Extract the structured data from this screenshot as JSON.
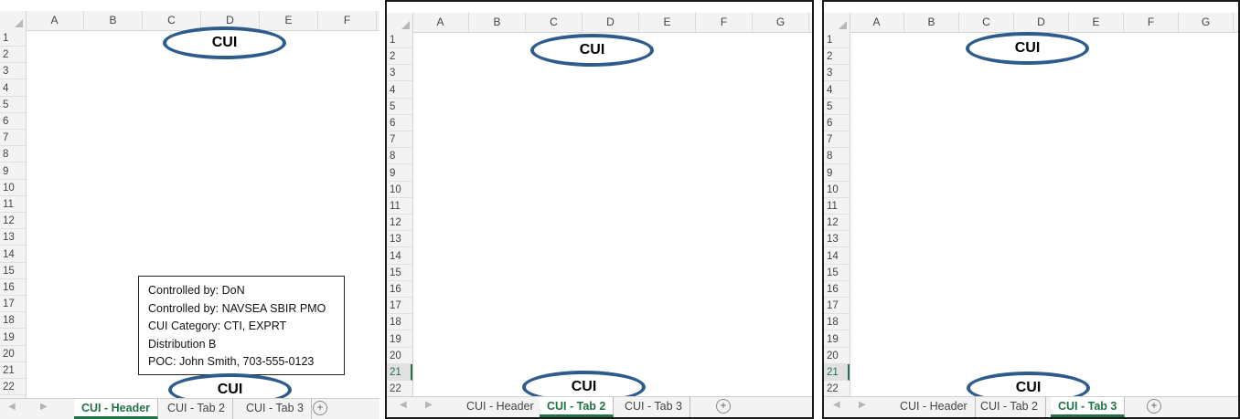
{
  "panes": [
    {
      "columns": [
        "A",
        "B",
        "C",
        "D",
        "E",
        "F"
      ],
      "rows": [
        "1",
        "2",
        "3",
        "4",
        "5",
        "6",
        "7",
        "8",
        "9",
        "10",
        "11",
        "12",
        "13",
        "14",
        "15",
        "16",
        "17",
        "18",
        "19",
        "20",
        "21",
        "22"
      ],
      "top_marking": "CUI",
      "bottom_marking": "CUI",
      "tabs": [
        "CUI - Header",
        "CUI - Tab 2",
        "CUI - Tab 3"
      ],
      "active_tab": 0,
      "selected_row": null
    },
    {
      "columns": [
        "A",
        "B",
        "C",
        "D",
        "E",
        "F",
        "G"
      ],
      "rows": [
        "1",
        "2",
        "3",
        "4",
        "5",
        "6",
        "7",
        "8",
        "9",
        "10",
        "11",
        "12",
        "13",
        "14",
        "15",
        "16",
        "17",
        "18",
        "19",
        "20",
        "21",
        "22"
      ],
      "top_marking": "CUI",
      "bottom_marking": "CUI",
      "tabs": [
        "CUI - Header",
        "CUI - Tab 2",
        "CUI - Tab 3"
      ],
      "active_tab": 1,
      "selected_row": "21"
    },
    {
      "columns": [
        "A",
        "B",
        "C",
        "D",
        "E",
        "F",
        "G"
      ],
      "rows": [
        "1",
        "2",
        "3",
        "4",
        "5",
        "6",
        "7",
        "8",
        "9",
        "10",
        "11",
        "12",
        "13",
        "14",
        "15",
        "16",
        "17",
        "18",
        "19",
        "20",
        "21",
        "22"
      ],
      "top_marking": "CUI",
      "bottom_marking": "CUI",
      "tabs": [
        "CUI - Header",
        "CUI - Tab 2",
        "CUI - Tab 3"
      ],
      "active_tab": 2,
      "selected_row": "21"
    }
  ],
  "info_box": {
    "lines": [
      "Controlled by: DoN",
      "Controlled by: NAVSEA SBIR PMO",
      "CUI Category:  CTI, EXPRT",
      "Distribution B",
      "POC: John Smith, 703-555-0123"
    ]
  },
  "icons": {
    "add_sheet": "plus-circle-icon",
    "scroll_left": "triangle-left-icon",
    "scroll_right": "triangle-right-icon"
  },
  "colors": {
    "accent": "#217346",
    "oval_border": "#2d5b8b"
  }
}
